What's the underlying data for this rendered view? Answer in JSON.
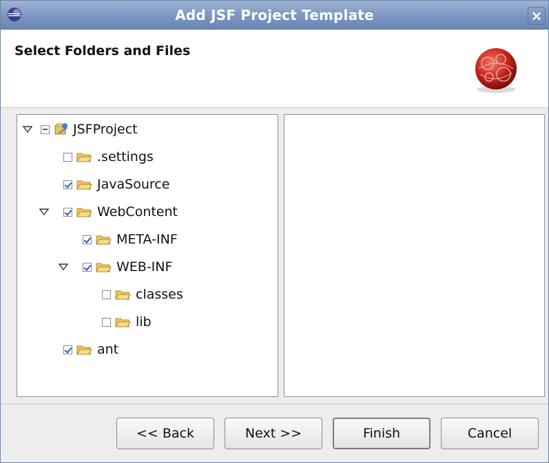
{
  "window": {
    "title": "Add JSF Project Template",
    "close_label": "×"
  },
  "banner": {
    "title": "Select Folders and Files"
  },
  "tree": {
    "root": {
      "label": "JSFProject",
      "expanded": true,
      "checkbox": "minus"
    },
    "items": [
      {
        "label": ".settings",
        "checked": false
      },
      {
        "label": "JavaSource",
        "checked": true
      },
      {
        "label": "WebContent",
        "checked": true,
        "expanded": true
      },
      {
        "label": "META-INF",
        "checked": true
      },
      {
        "label": "WEB-INF",
        "checked": true,
        "expanded": true
      },
      {
        "label": "classes",
        "checked": false
      },
      {
        "label": "lib",
        "checked": false
      },
      {
        "label": "ant",
        "checked": true
      }
    ]
  },
  "buttons": {
    "back": "<< Back",
    "next": "Next >>",
    "finish": "Finish",
    "cancel": "Cancel"
  },
  "colors": {
    "titlebar": "#7a96c0",
    "check_mark": "#2d5fa3",
    "folder": "#e9b94a",
    "logo_red": "#c7251b"
  }
}
